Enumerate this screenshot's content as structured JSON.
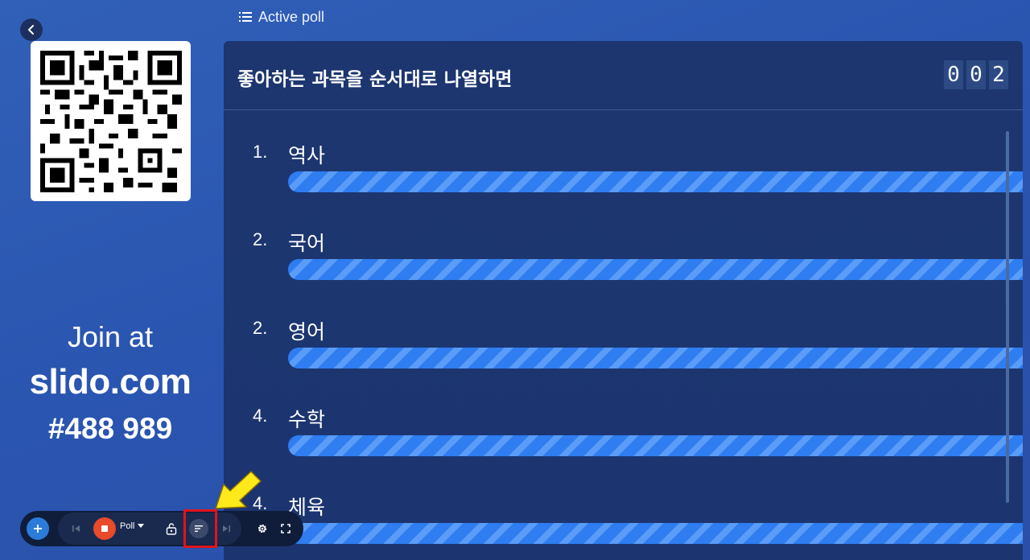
{
  "header": {
    "label": "Active poll",
    "icon": "list-icon"
  },
  "join": {
    "label": "Join at",
    "url": "slido.com",
    "code": "#488 989"
  },
  "poll": {
    "question": "좋아하는 과목을 순서대로 나열하면",
    "response_count_digits": [
      "0",
      "0",
      "2"
    ],
    "options": [
      {
        "rank": "1.",
        "text": "역사",
        "fill_percent": 100
      },
      {
        "rank": "2.",
        "text": "국어",
        "fill_percent": 100
      },
      {
        "rank": "2.",
        "text": "영어",
        "fill_percent": 100
      },
      {
        "rank": "4.",
        "text": "수학",
        "fill_percent": 100
      },
      {
        "rank": "4.",
        "text": "체육",
        "fill_percent": 100
      }
    ]
  },
  "toolbar": {
    "poll_label": "Poll",
    "buttons": [
      "add-icon",
      "previous-icon",
      "stop-icon",
      "lock-icon",
      "sort-icon",
      "next-icon",
      "gear-icon",
      "fullscreen-icon"
    ]
  },
  "colors": {
    "bar_primary": "#2f7df0",
    "bar_stripe": "#5a9cf7",
    "stop": "#e84a2a",
    "highlight": "#e0141c",
    "arrow": "#ffe91a"
  }
}
